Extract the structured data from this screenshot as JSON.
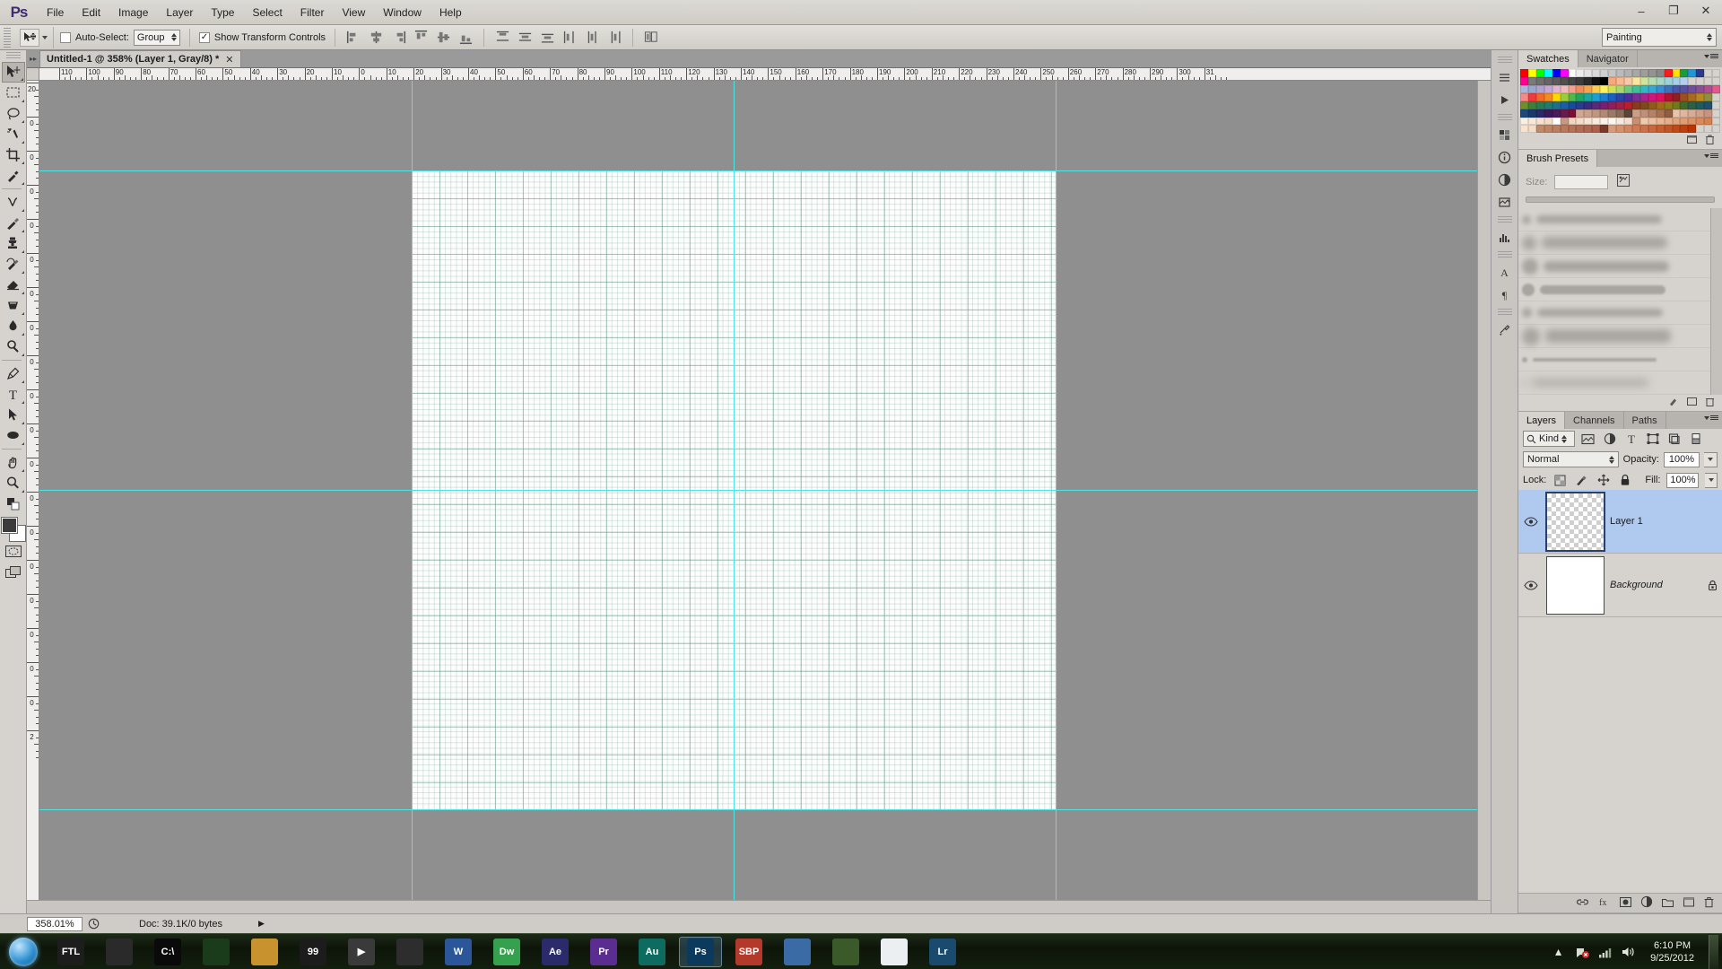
{
  "app": {
    "name": "Ps",
    "logo_text": "Ps"
  },
  "menubar": {
    "items": [
      "File",
      "Edit",
      "Image",
      "Layer",
      "Type",
      "Select",
      "Filter",
      "View",
      "Window",
      "Help"
    ],
    "minimize": "–",
    "maximize": "❐",
    "close": "✕"
  },
  "options_bar": {
    "tool_icon": "move-tool",
    "auto_select_checked": false,
    "auto_select_label": "Auto-Select:",
    "auto_select_value": "Group",
    "show_transform_checked": true,
    "show_transform_label": "Show Transform Controls",
    "show_transform_check": "✓",
    "align_buttons": [
      "align-left-edges",
      "align-horizontal-centers",
      "align-right-edges",
      "align-top-edges",
      "align-vertical-centers",
      "align-bottom-edges",
      "distribute-top-edges",
      "distribute-vertical-centers",
      "distribute-bottom-edges",
      "distribute-left-edges",
      "distribute-horizontal-centers",
      "distribute-right-edges",
      "auto-align-layers"
    ],
    "workspace": "Painting"
  },
  "document": {
    "tab_title": "Untitled-1 @ 358% (Layer 1, Gray/8) *",
    "close_glyph": "✕"
  },
  "rulers": {
    "unit": "px",
    "h_labels": [
      "110",
      "100",
      "90",
      "80",
      "70",
      "60",
      "50",
      "40",
      "30",
      "20",
      "10",
      "0",
      "10",
      "20",
      "30",
      "40",
      "50",
      "60",
      "70",
      "80",
      "90",
      "100",
      "110",
      "120",
      "130",
      "140",
      "150",
      "160",
      "170",
      "180",
      "190",
      "200",
      "210",
      "220",
      "230",
      "240",
      "250",
      "260",
      "270",
      "280",
      "290",
      "300",
      "31"
    ],
    "v_labels": [
      "20",
      "0",
      "0",
      "0",
      "0",
      "0",
      "0",
      "0",
      "0",
      "0",
      "0",
      "0",
      "0",
      "0",
      "0",
      "0",
      "0",
      "0",
      "0",
      "2"
    ]
  },
  "canvas": {
    "guides_vertical": [
      "guide-1",
      "guide-2"
    ],
    "guides_horizontal": [
      "guide-1",
      "guide-2"
    ],
    "grid_visible": true
  },
  "status_bar": {
    "zoom": "358.01%",
    "doc_info": "Doc: 39.1K/0 bytes",
    "arrow": "▶"
  },
  "rail": {
    "buttons": [
      "history-icon",
      "actions-icon",
      "info-icon",
      "color-icon",
      "adjustments-icon",
      "styles-icon",
      "histogram-icon",
      "character-icon",
      "paragraph-icon",
      "tool-presets-icon"
    ]
  },
  "toolbar": {
    "tools": [
      {
        "name": "move-tool",
        "active": true
      },
      {
        "name": "rectangular-marquee-tool",
        "active": false
      },
      {
        "name": "lasso-tool",
        "active": false
      },
      {
        "name": "magic-wand-tool",
        "active": false
      },
      {
        "name": "crop-tool",
        "active": false
      },
      {
        "name": "eyedropper-tool",
        "active": false
      },
      {
        "name": "healing-brush-tool",
        "active": false
      },
      {
        "name": "brush-tool",
        "active": false
      },
      {
        "name": "clone-stamp-tool",
        "active": false
      },
      {
        "name": "history-brush-tool",
        "active": false
      },
      {
        "name": "eraser-tool",
        "active": false
      },
      {
        "name": "gradient-tool",
        "active": false
      },
      {
        "name": "blur-tool",
        "active": false
      },
      {
        "name": "dodge-tool",
        "active": false
      },
      {
        "name": "pen-tool",
        "active": false
      },
      {
        "name": "horizontal-type-tool",
        "active": false
      },
      {
        "name": "path-selection-tool",
        "active": false
      },
      {
        "name": "ellipse-tool",
        "active": false
      },
      {
        "name": "hand-tool",
        "active": false
      },
      {
        "name": "zoom-tool",
        "active": false
      }
    ],
    "foreground_color": "#3b3b3b",
    "background_color": "#ffffff"
  },
  "panels": {
    "swatches": {
      "tabs": [
        {
          "label": "Swatches",
          "active": true
        },
        {
          "label": "Navigator",
          "active": false
        }
      ],
      "colors": [
        "#ff0000",
        "#ffff00",
        "#00ff00",
        "#00ffff",
        "#0000ff",
        "#ff00ff",
        "#ffffff",
        "#ededed",
        "#e3e3e3",
        "#d9d9d9",
        "#cfcfcf",
        "#c5c5c5",
        "#bbbbbb",
        "#b1b1b1",
        "#a7a7a7",
        "#9d9d9d",
        "#939393",
        "#898989",
        "#ff1a1a",
        "#ffe400",
        "#1a9c3d",
        "#2196d9",
        "#2b3a8f",
        "#d6d3ce",
        "#d6d3ce",
        "#ff0090",
        "#7a7a7a",
        "#6f6f6f",
        "#656565",
        "#5b5b5b",
        "#4f4f4f",
        "#454545",
        "#3b3b3b",
        "#2a2a2a",
        "#111111",
        "#000000",
        "#f8a87a",
        "#f9b993",
        "#f7c9a8",
        "#fbe6a0",
        "#cfe39a",
        "#b8ddb3",
        "#a9d7c4",
        "#9ed2d8",
        "#a6cfe8",
        "#b4cdf0",
        "#d6d3ce",
        "#d6d3ce",
        "#d6d3ce",
        "#d6d3ce",
        "#a8b6d8",
        "#9aa7cf",
        "#b0a3cf",
        "#c6a8d2",
        "#e3b4cf",
        "#f0b9bb",
        "#f3a18c",
        "#f08a5c",
        "#f3a44f",
        "#f8cd4f",
        "#fff05a",
        "#cfe05a",
        "#a8d86a",
        "#6fc97e",
        "#3fbf9a",
        "#35b7c2",
        "#36a6d4",
        "#3b8cd0",
        "#4170bd",
        "#4a57a8",
        "#5a4f9e",
        "#6f4f9b",
        "#8a4f96",
        "#b04f90",
        "#e4598c",
        "#f58a8a",
        "#ef3b3b",
        "#f26a2a",
        "#f58a1f",
        "#fbd900",
        "#9ccc3a",
        "#4fb84f",
        "#1ea85f",
        "#1aa6a0",
        "#1c9fd0",
        "#1d7fd0",
        "#1a5fc0",
        "#2a43a8",
        "#4a2f9b",
        "#7a2f95",
        "#a8238c",
        "#d1157a",
        "#e01060",
        "#b3122e",
        "#8f1f1f",
        "#9a4f1f",
        "#a86a1f",
        "#b8891f",
        "#8f8f3f",
        "#d6d3ce",
        "#6f8f2a",
        "#3f7f3a",
        "#2a7a55",
        "#1f7a70",
        "#1d6f8f",
        "#1a5f9f",
        "#1a4a9a",
        "#2a3a8f",
        "#3a2a80",
        "#5a2a7a",
        "#7a1f70",
        "#8f1f5a",
        "#a31f45",
        "#b81f2a",
        "#8a3a1a",
        "#7a4a1a",
        "#8f5a1a",
        "#a06a1a",
        "#8f7a1a",
        "#6f7a1a",
        "#3f6a2a",
        "#2a5f4a",
        "#1f5a5f",
        "#1f4f6f",
        "#d6d3ce",
        "#1a4a7a",
        "#183a6a",
        "#2a2a6a",
        "#3a1a5a",
        "#4a1a5a",
        "#6a1a4a",
        "#7a1030",
        "#cfa893",
        "#c9a08c",
        "#bf9682",
        "#b08a76",
        "#9a7a68",
        "#8a6a58",
        "#5a4538",
        "#c9a087",
        "#bf9077",
        "#b58268",
        "#a8714f",
        "#8f5f3f",
        "#e8c3ae",
        "#e0b69f",
        "#d8ab94",
        "#cfa089",
        "#c59580",
        "#d6d3ce",
        "#fbeee3",
        "#f9e8da",
        "#f7e2d1",
        "#f5dcc8",
        "#ffffff",
        "#c39a84",
        "#f3d6c0",
        "#f5ddc9",
        "#f7e4d3",
        "#f9ebdc",
        "#fbf1e6",
        "#fdf6ef",
        "#f7e9dd",
        "#f3ddcc",
        "#c98f6f",
        "#efc9ae",
        "#ecc0a2",
        "#e9b796",
        "#e6ae8a",
        "#e3a57e",
        "#e09c72",
        "#dd9366",
        "#da8a5a",
        "#d7814e",
        "#d6d3ce",
        "#f7e3d2",
        "#f4dcc8",
        "#c08a68",
        "#bf8464",
        "#bc7e60",
        "#b9785c",
        "#b67258",
        "#b36c54",
        "#b06650",
        "#ad604c",
        "#7a3a2a",
        "#d89a78",
        "#d5906c",
        "#d28660",
        "#cf7c54",
        "#cc7248",
        "#c9683c",
        "#c65e30",
        "#c35424",
        "#c04a18",
        "#bd400c",
        "#ba3600",
        "#d6d3ce",
        "#d6d3ce",
        "#d6d3ce"
      ],
      "footer_buttons": [
        "new-swatch-icon",
        "delete-swatch-icon"
      ]
    },
    "brush_presets": {
      "tabs": [
        {
          "label": "Brush Presets",
          "active": true
        }
      ],
      "size_label": "Size:",
      "size_value": "",
      "toggle_icon": "brush-panel-icon",
      "rows": [
        {
          "name": "soft-round-small",
          "dot": 10,
          "stroke_h": 9,
          "stroke_w": 140,
          "blur": 3
        },
        {
          "name": "soft-round-medium",
          "dot": 16,
          "stroke_h": 13,
          "stroke_w": 140,
          "blur": 4
        },
        {
          "name": "soft-round-large",
          "dot": 18,
          "stroke_h": 12,
          "stroke_w": 140,
          "blur": 3
        },
        {
          "name": "hard-round",
          "dot": 14,
          "stroke_h": 10,
          "stroke_w": 140,
          "blur": 1
        },
        {
          "name": "soft-round-wide",
          "dot": 11,
          "stroke_h": 9,
          "stroke_w": 140,
          "blur": 3
        },
        {
          "name": "airbrush-soft",
          "dot": 20,
          "stroke_h": 15,
          "stroke_w": 140,
          "blur": 4
        },
        {
          "name": "flat-tip",
          "dot": 6,
          "stroke_h": 4,
          "stroke_w": 138,
          "blur": 1
        },
        {
          "name": "spatter",
          "dot": 5,
          "stroke_h": 7,
          "stroke_w": 130,
          "blur": 5
        }
      ],
      "footer_buttons": [
        "brush-panel-toggle",
        "new-brush-preset",
        "delete-brush-preset"
      ]
    },
    "layers": {
      "tabs": [
        {
          "label": "Layers",
          "active": true
        },
        {
          "label": "Channels",
          "active": false
        },
        {
          "label": "Paths",
          "active": false
        }
      ],
      "filter_label": "Kind",
      "filter_icons": [
        "filter-pixel-icon",
        "filter-adjustment-icon",
        "filter-type-icon",
        "filter-shape-icon",
        "filter-smart-icon",
        "filter-toggle-icon"
      ],
      "blend_mode": "Normal",
      "opacity_label": "Opacity:",
      "opacity_value": "100%",
      "lock_label": "Lock:",
      "lock_icons": [
        "lock-transparent-pixels-icon",
        "lock-image-pixels-icon",
        "lock-position-icon",
        "lock-all-icon"
      ],
      "fill_label": "Fill:",
      "fill_value": "100%",
      "rows": [
        {
          "name": "Layer 1",
          "selected": true,
          "visible": true,
          "locked": false,
          "thumb": "transparent",
          "italic": false
        },
        {
          "name": "Background",
          "selected": false,
          "visible": true,
          "locked": true,
          "thumb": "white",
          "italic": true
        }
      ],
      "footer_buttons": [
        "link-layers-icon",
        "layer-style-icon",
        "layer-mask-icon",
        "adjustment-layer-icon",
        "new-group-icon",
        "new-layer-icon",
        "delete-layer-icon"
      ]
    }
  },
  "taskbar": {
    "start": "start-orb",
    "items": [
      {
        "name": "ftl-game",
        "label": "FTL",
        "color": "#1d1d1d",
        "active": false
      },
      {
        "name": "audio-recorder",
        "label": "",
        "color": "#2a2a2a",
        "active": false
      },
      {
        "name": "command-prompt",
        "label": "C:\\",
        "color": "#0a0a0a",
        "active": false
      },
      {
        "name": "utorrent",
        "label": "",
        "color": "#1b3c1b",
        "active": false
      },
      {
        "name": "file-explorer",
        "label": "",
        "color": "#c8932f",
        "active": false
      },
      {
        "name": "notepad-99",
        "label": "99",
        "color": "#1c1c1c",
        "active": false
      },
      {
        "name": "media-player",
        "label": "▶",
        "color": "#3a3a3a",
        "active": false
      },
      {
        "name": "clock-app",
        "label": "",
        "color": "#2d2d2d",
        "active": false
      },
      {
        "name": "microsoft-word",
        "label": "W",
        "color": "#2b579a",
        "active": false
      },
      {
        "name": "dreamweaver",
        "label": "Dw",
        "color": "#35a14f",
        "active": false
      },
      {
        "name": "after-effects",
        "label": "Ae",
        "color": "#2b2b6b",
        "active": false
      },
      {
        "name": "premiere-pro",
        "label": "Pr",
        "color": "#5c2d91",
        "active": false
      },
      {
        "name": "audition",
        "label": "Au",
        "color": "#0d6b5f",
        "active": false
      },
      {
        "name": "photoshop",
        "label": "Ps",
        "color": "#0b3a5d",
        "active": true
      },
      {
        "name": "sbp-app",
        "label": "SBP",
        "color": "#b33a2a",
        "active": false
      },
      {
        "name": "paint-app",
        "label": "",
        "color": "#3a6ba5",
        "active": false
      },
      {
        "name": "gimp-app",
        "label": "",
        "color": "#3a5a2a",
        "active": false
      },
      {
        "name": "google-chrome",
        "label": "",
        "color": "#eceff1",
        "active": false
      },
      {
        "name": "lightroom-app",
        "label": "Lr",
        "color": "#1a4a6e",
        "active": false
      }
    ],
    "tray": {
      "show_hidden": "▲",
      "network_icon": "network-error-icon",
      "signal_icon": "signal-icon",
      "volume_icon": "volume-icon",
      "time": "6:10 PM",
      "date": "9/25/2012"
    }
  }
}
